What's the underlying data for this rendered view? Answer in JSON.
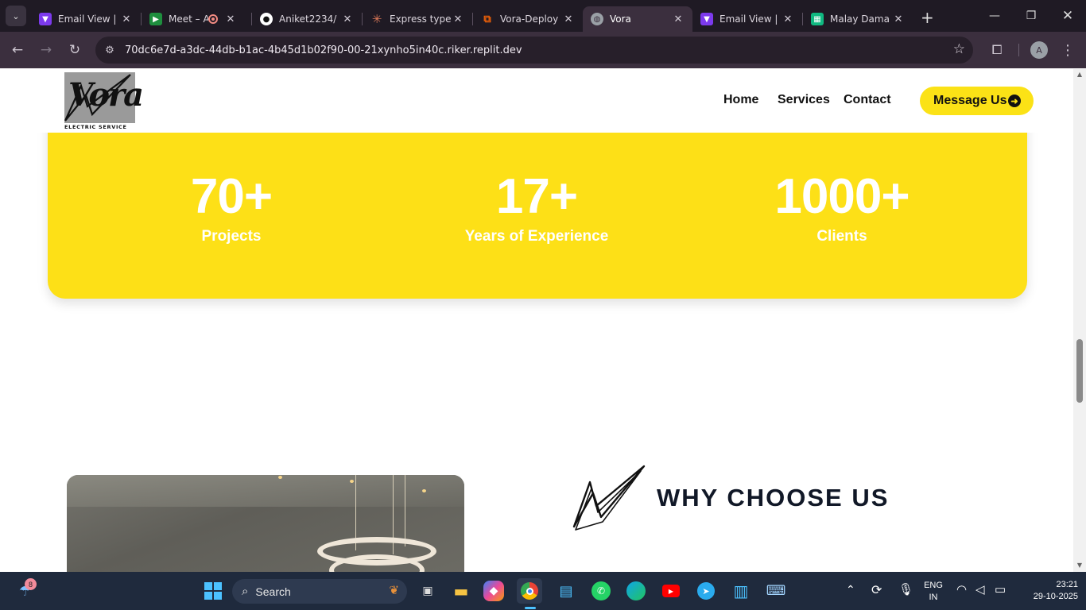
{
  "browser": {
    "tabs": [
      {
        "label": "Email View |",
        "icon": "vite-icon",
        "color": "#a78bfa"
      },
      {
        "label": "Meet – A",
        "icon": "google-meet-icon",
        "color": "#34a853",
        "recording": true
      },
      {
        "label": "Aniket2234/",
        "icon": "github-icon",
        "color": "#ffffff"
      },
      {
        "label": "Express type",
        "icon": "claude-icon",
        "color": "#d97757"
      },
      {
        "label": "Vora-Deploy",
        "icon": "replit-icon",
        "color": "#f26207"
      },
      {
        "label": "Vora",
        "icon": "globe-icon",
        "color": "#9aa0a6",
        "active": true
      },
      {
        "label": "Email View |",
        "icon": "vite-icon",
        "color": "#a78bfa"
      },
      {
        "label": "Malay Dama",
        "icon": "sheets-icon",
        "color": "#10b981"
      }
    ],
    "url": "70dc6e7d-a3dc-44db-b1ac-4b45d1b02f90-00-21xynho5in40c.riker.replit.dev",
    "profile_initial": "A"
  },
  "site": {
    "logo": {
      "word": "Vora",
      "subtitle": "ELECTRIC SERVICE"
    },
    "nav": [
      "Home",
      "Services",
      "Contact"
    ],
    "cta": "Message Us",
    "stats": [
      {
        "value": "70+",
        "label": "Projects"
      },
      {
        "value": "17+",
        "label": "Years of Experience"
      },
      {
        "value": "1000+",
        "label": "Clients"
      }
    ],
    "why_title": "WHY CHOOSE US",
    "accent_color": "#fde017"
  },
  "taskbar": {
    "search_placeholder": "Search",
    "weather_badge": "8",
    "lang_line1": "ENG",
    "lang_line2": "IN",
    "time": "23:21",
    "date": "29-10-2025"
  }
}
